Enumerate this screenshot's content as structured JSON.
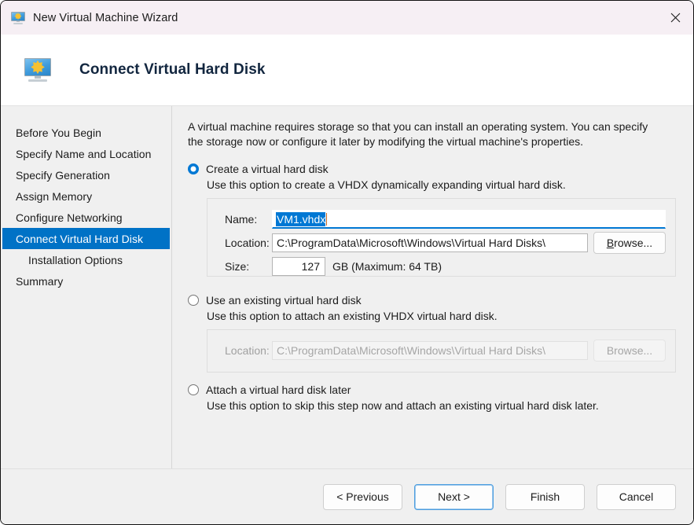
{
  "window": {
    "title": "New Virtual Machine Wizard",
    "icon": "virtual-machine-monitor-icon",
    "close_label": "×"
  },
  "header": {
    "title": "Connect Virtual Hard Disk",
    "icon": "virtual-machine-monitor-icon"
  },
  "sidebar": {
    "items": [
      {
        "label": "Before You Begin",
        "selected": false,
        "sub": false
      },
      {
        "label": "Specify Name and Location",
        "selected": false,
        "sub": false
      },
      {
        "label": "Specify Generation",
        "selected": false,
        "sub": false
      },
      {
        "label": "Assign Memory",
        "selected": false,
        "sub": false
      },
      {
        "label": "Configure Networking",
        "selected": false,
        "sub": false
      },
      {
        "label": "Connect Virtual Hard Disk",
        "selected": true,
        "sub": false
      },
      {
        "label": "Installation Options",
        "selected": false,
        "sub": true
      },
      {
        "label": "Summary",
        "selected": false,
        "sub": false
      }
    ]
  },
  "main": {
    "intro": "A virtual machine requires storage so that you can install an operating system. You can specify the storage now or configure it later by modifying the virtual machine's properties.",
    "option_create": {
      "label": "Create a virtual hard disk",
      "selected": true,
      "hint": "Use this option to create a VHDX dynamically expanding virtual hard disk.",
      "name_label": "Name:",
      "name_value": "VM1.vhdx",
      "location_label": "Location:",
      "location_value": "C:\\ProgramData\\Microsoft\\Windows\\Virtual Hard Disks\\",
      "browse_label": "Browse...",
      "size_label": "Size:",
      "size_value": "127",
      "size_suffix": "GB (Maximum: 64 TB)"
    },
    "option_existing": {
      "label": "Use an existing virtual hard disk",
      "selected": false,
      "hint": "Use this option to attach an existing VHDX virtual hard disk.",
      "location_label": "Location:",
      "location_value": "C:\\ProgramData\\Microsoft\\Windows\\Virtual Hard Disks\\",
      "browse_label": "Browse..."
    },
    "option_later": {
      "label": "Attach a virtual hard disk later",
      "selected": false,
      "hint": "Use this option to skip this step now and attach an existing virtual hard disk later."
    }
  },
  "footer": {
    "previous": "< Previous",
    "next": "Next >",
    "finish": "Finish",
    "cancel": "Cancel"
  },
  "colors": {
    "accent": "#0078d4",
    "selection": "#0072c6",
    "titlebar": "#f6eff4",
    "body": "#f0f0f0"
  }
}
